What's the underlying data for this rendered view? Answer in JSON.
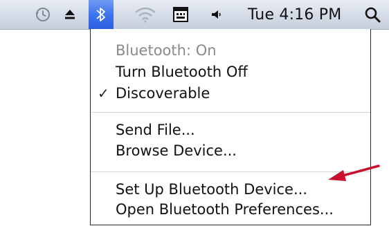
{
  "menubar": {
    "clock": "Tue 4:16 PM",
    "icons": [
      "time-machine-icon",
      "eject-icon",
      "bluetooth-icon",
      "wifi-icon",
      "keyboard-viewer-icon",
      "volume-icon",
      "spotlight-icon"
    ]
  },
  "bluetooth_menu": {
    "status": "Bluetooth: On",
    "items": {
      "turn_off": "Turn Bluetooth Off",
      "discoverable": "Discoverable",
      "discoverable_check": "✓",
      "send_file": "Send File...",
      "browse_device": "Browse Device...",
      "set_up_device": "Set Up Bluetooth Device...",
      "open_prefs": "Open Bluetooth Preferences..."
    }
  },
  "colors": {
    "menubar": "#d4dbe6",
    "highlight": "#3f74ee",
    "arrow": "#c8102e"
  }
}
